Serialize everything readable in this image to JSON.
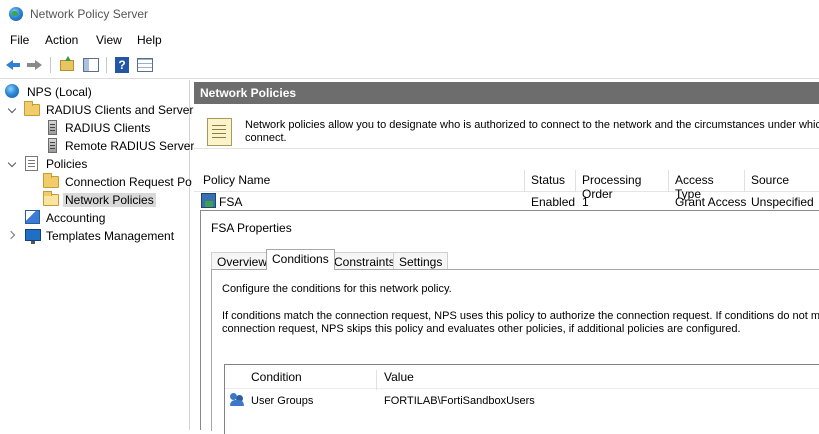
{
  "window": {
    "title": "Network Policy Server"
  },
  "menu": {
    "items": [
      "File",
      "Action",
      "View",
      "Help"
    ]
  },
  "tree": {
    "root": "NPS (Local)",
    "radius_group": "RADIUS Clients and Servers",
    "radius_clients": "RADIUS Clients",
    "remote_radius": "Remote RADIUS Server",
    "policies": "Policies",
    "connection_request": "Connection Request Po",
    "network_policies": "Network Policies",
    "accounting": "Accounting",
    "templates": "Templates Management"
  },
  "main": {
    "header": "Network Policies",
    "info_line1": "Network policies allow you to designate who is authorized to connect to the network and the circumstances under which th",
    "info_line2": "connect.",
    "columns": [
      "Policy Name",
      "Status",
      "Processing Order",
      "Access Type",
      "Source"
    ],
    "rows": [
      {
        "name": "FSA",
        "status": "Enabled",
        "order": "1",
        "access": "Grant Access",
        "source": "Unspecified"
      }
    ]
  },
  "dialog": {
    "title": "FSA Properties",
    "tabs": [
      "Overview",
      "Conditions",
      "Constraints",
      "Settings"
    ],
    "active_tab": "Conditions",
    "intro": "Configure the conditions for this network policy.",
    "desc_line1": "If conditions match the connection request, NPS uses this policy to authorize the connection request. If conditions do not match",
    "desc_line2": "connection request, NPS skips this policy and evaluates other policies, if additional policies are configured.",
    "conditions": {
      "columns": [
        "Condition",
        "Value"
      ],
      "rows": [
        {
          "condition": "User Groups",
          "value": "FORTILAB\\FortiSandboxUsers"
        }
      ]
    }
  }
}
